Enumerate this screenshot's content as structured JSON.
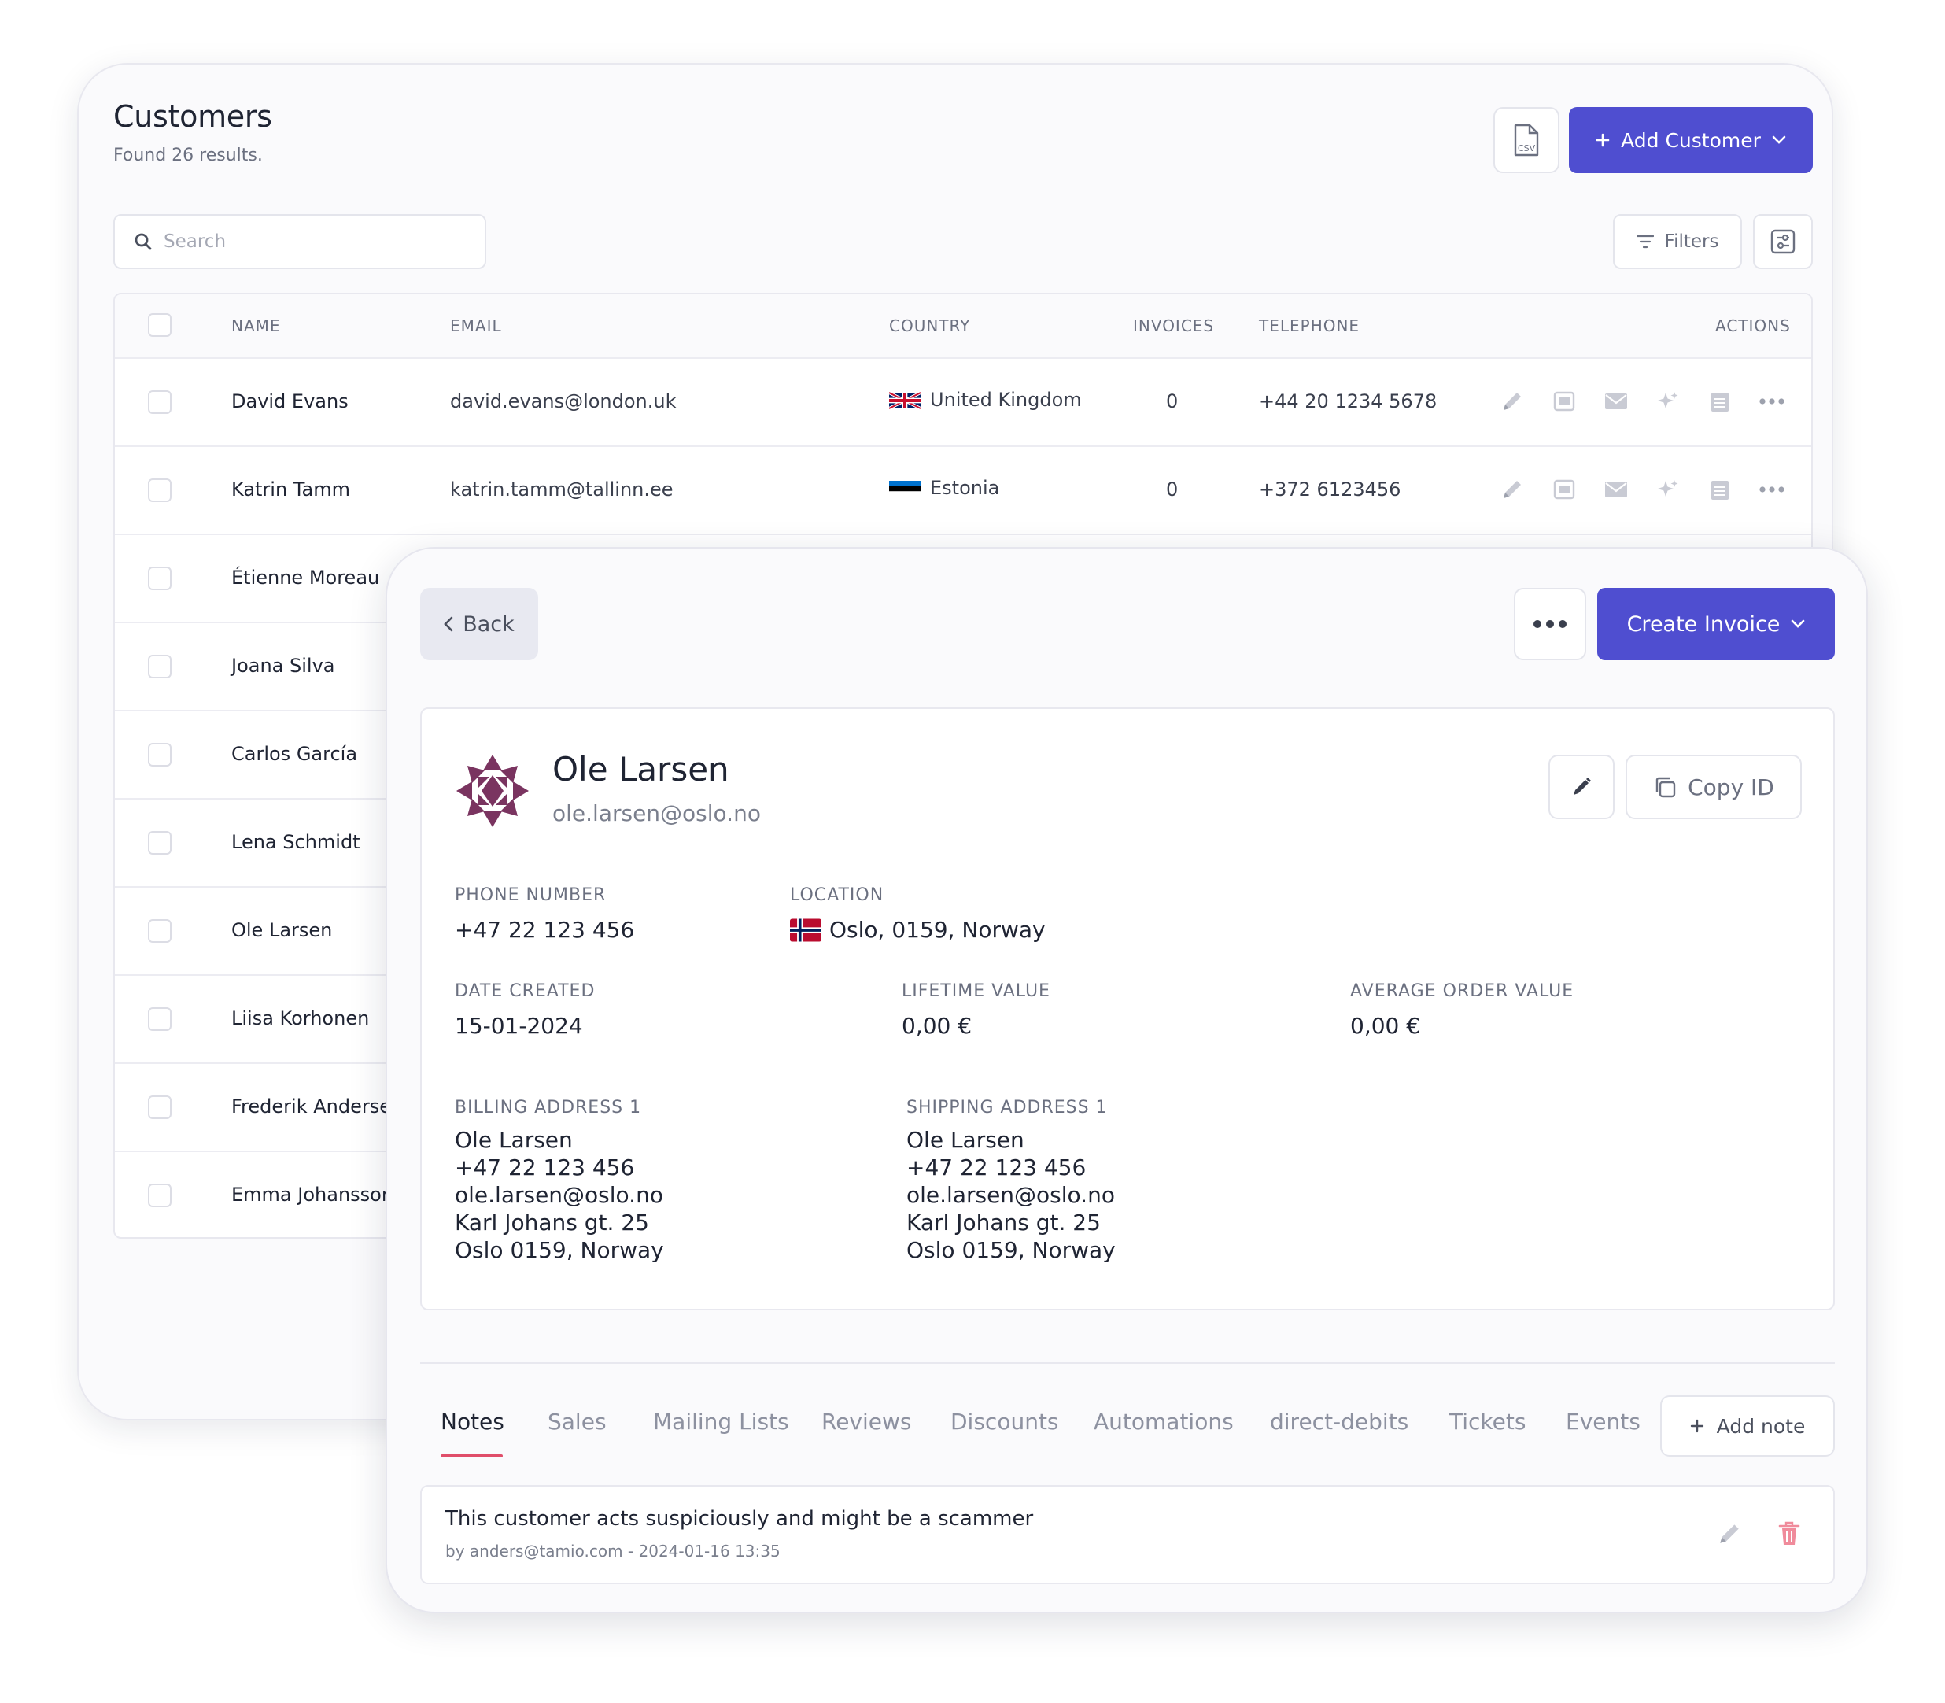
{
  "list": {
    "title": "Customers",
    "subtitle": "Found 26 results.",
    "csv_icon": "csv-file-icon",
    "add_customer_label": "Add Customer",
    "search_placeholder": "Search",
    "filters_label": "Filters",
    "columns": [
      "NAME",
      "EMAIL",
      "COUNTRY",
      "INVOICES",
      "TELEPHONE",
      "ACTIONS"
    ],
    "rows": [
      {
        "name": "David Evans",
        "email": "david.evans@london.uk",
        "country": "United Kingdom",
        "flag": "gb",
        "invoices": "0",
        "telephone": "+44 20 1234 5678"
      },
      {
        "name": "Katrin Tamm",
        "email": "katrin.tamm@tallinn.ee",
        "country": "Estonia",
        "flag": "ee",
        "invoices": "0",
        "telephone": "+372 6123456"
      },
      {
        "name": "Étienne Moreau"
      },
      {
        "name": "Joana Silva"
      },
      {
        "name": "Carlos García"
      },
      {
        "name": "Lena Schmidt"
      },
      {
        "name": "Ole Larsen"
      },
      {
        "name": "Liisa Korhonen"
      },
      {
        "name": "Frederik Anderse"
      },
      {
        "name": "Emma Johanssor"
      }
    ],
    "row_action_icons": [
      "pencil-icon",
      "pdf-icon",
      "mail-icon",
      "sparkle-icon",
      "calendar-icon",
      "more-dots-icon"
    ]
  },
  "detail": {
    "back_label": "Back",
    "create_invoice_label": "Create Invoice",
    "customer": {
      "name": "Ole Larsen",
      "email": "ole.larsen@oslo.no"
    },
    "copy_id_label": "Copy ID",
    "fields": {
      "phone_label": "PHONE NUMBER",
      "phone": "+47 22 123 456",
      "location_label": "LOCATION",
      "location": "Oslo, 0159, Norway",
      "date_created_label": "DATE CREATED",
      "date_created": "15-01-2024",
      "lifetime_value_label": "LIFETIME VALUE",
      "lifetime_value": "0,00 €",
      "aov_label": "AVERAGE ORDER VALUE",
      "aov": "0,00 €"
    },
    "billing": {
      "label": "BILLING ADDRESS 1",
      "lines": [
        "Ole Larsen",
        "+47 22 123 456",
        "ole.larsen@oslo.no",
        "Karl Johans gt. 25",
        "Oslo 0159, Norway"
      ]
    },
    "shipping": {
      "label": "SHIPPING ADDRESS 1",
      "lines": [
        "Ole Larsen",
        "+47 22 123 456",
        "ole.larsen@oslo.no",
        "Karl Johans gt. 25",
        "Oslo 0159, Norway"
      ]
    },
    "tabs": [
      "Notes",
      "Sales",
      "Mailing Lists",
      "Reviews",
      "Discounts",
      "Automations",
      "direct-debits",
      "Tickets",
      "Events"
    ],
    "active_tab": "Notes",
    "add_note_label": "Add note",
    "note": {
      "text": "This customer acts suspiciously and might be a scammer",
      "meta": "by anders@tamio.com - 2024-01-16 13:35"
    }
  },
  "colors": {
    "primary": "#4f4ed0",
    "active_tab_underline": "#e04e6a",
    "delete_icon": "#f08b9b",
    "avatar": "#7a3460"
  }
}
